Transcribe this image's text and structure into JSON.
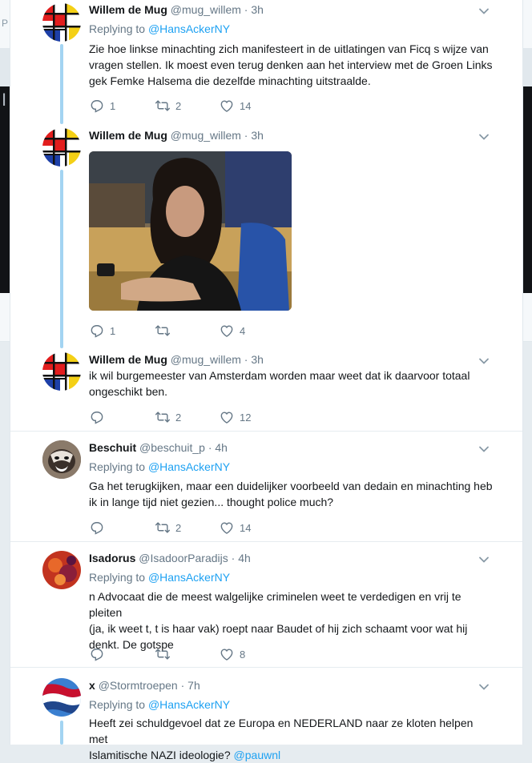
{
  "background": {
    "left_char_1": "P",
    "left_char_2": "I"
  },
  "tweets": [
    {
      "name": "Willem de Mug",
      "handle": "@mug_willem",
      "time": "· 3h",
      "replying_prefix": "Replying to",
      "replying_to": "@HansAckerNY",
      "lines": [
        "Zie hoe linkse minachting zich manifesteert in de uitlatingen van  Ficq s wijze van",
        "vragen stellen.  Ik moest even terug denken aan het interview met de Groen Links",
        "gek Femke Halsema die dezelfde minachting uitstraalde."
      ],
      "replies": "1",
      "retweets": "2",
      "likes": "14"
    },
    {
      "name": "Willem de Mug",
      "handle": "@mug_willem",
      "time": "· 3h",
      "replies": "1",
      "retweets": "",
      "likes": "4"
    },
    {
      "name": "Willem de Mug",
      "handle": "@mug_willem",
      "time": "· 3h",
      "lines": [
        "ik wil burgemeester van Amsterdam worden maar weet dat ik daarvoor totaal",
        "ongeschikt ben."
      ],
      "replies": "",
      "retweets": "2",
      "likes": "12"
    },
    {
      "name": "Beschuit",
      "handle": "@beschuit_p",
      "time": "· 4h",
      "replying_prefix": "Replying to",
      "replying_to": "@HansAckerNY",
      "lines": [
        "Ga het terugkijken, maar een duidelijker voorbeeld van dedain en minachting heb",
        "ik in lange tijd niet gezien... thought police much?"
      ],
      "replies": "",
      "retweets": "2",
      "likes": "14"
    },
    {
      "name": "Isadorus",
      "handle": "@IsadoorParadijs",
      "time": "· 4h",
      "replying_prefix": "Replying to",
      "replying_to": "@HansAckerNY",
      "lines": [
        "n Advocaat die de meest walgelijke criminelen weet te verdedigen en vrij te pleiten",
        "(ja, ik weet t, t is haar vak) roept naar Baudet of hij zich schaamt voor wat hij",
        "denkt. De gotspe"
      ],
      "replies": "",
      "retweets": "",
      "likes": "8"
    },
    {
      "name": "x",
      "handle": "@Stormtroepen",
      "time": "· 7h",
      "replying_prefix": "Replying to",
      "replying_to": "@HansAckerNY",
      "lines": [
        "Heeft zei schuldgevoel dat ze Europa en NEDERLAND naar ze kloten helpen met"
      ],
      "line_last_text": "Islamitische NAZI ideologie?",
      "line_last_link": "@pauwnl",
      "replies": "",
      "retweets": "",
      "likes": ""
    }
  ],
  "colors": {
    "link": "#1da1f2",
    "thread_line": "#a3d4f2",
    "muted": "#657786"
  },
  "icons": [
    "reply-icon",
    "retweet-icon",
    "like-icon",
    "chevron-down-icon"
  ]
}
